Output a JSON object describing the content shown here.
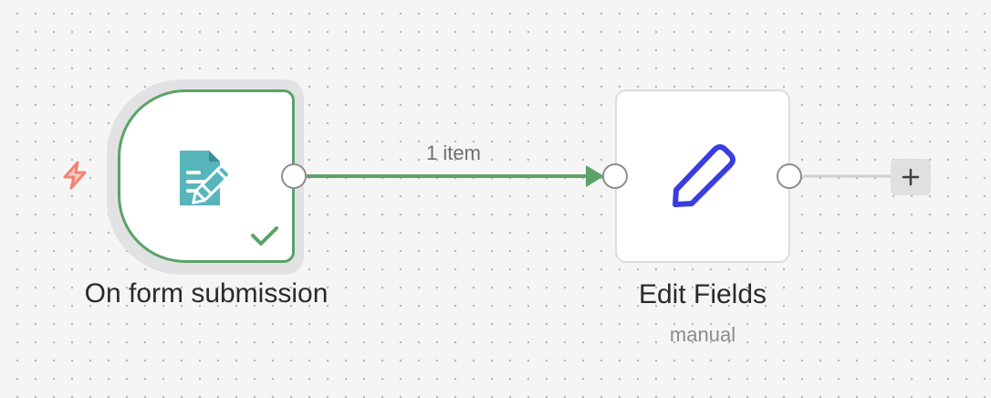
{
  "workflow": {
    "connection": {
      "item_count_label": "1 item",
      "color": "#5aa367"
    },
    "nodes": [
      {
        "id": "trigger",
        "name": "On form submission",
        "icon": "form-edit-icon",
        "icon_color": "#57b6bc",
        "status": "success",
        "is_trigger": true,
        "trigger_icon": "bolt-icon",
        "trigger_icon_color": "#f4826f"
      },
      {
        "id": "edit",
        "name": "Edit Fields",
        "subtitle": "manual",
        "icon": "pencil-icon",
        "icon_color": "#3a3de0"
      }
    ],
    "add_node_button": {
      "icon": "plus-icon"
    }
  }
}
